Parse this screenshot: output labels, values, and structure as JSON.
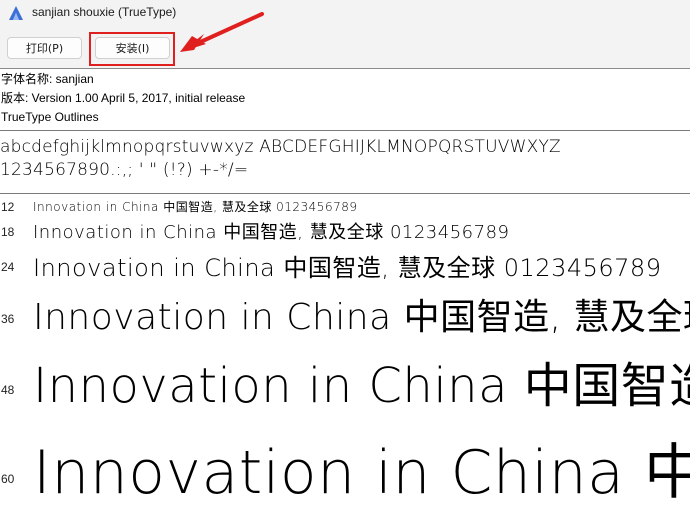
{
  "window": {
    "title": "sanjian shouxie (TrueType)"
  },
  "toolbar": {
    "print_label": "打印(P)",
    "install_label": "安装(I)"
  },
  "font_info": {
    "name_line": "字体名称: sanjian",
    "version_line": "版本: Version 1.00 April 5, 2017, initial release",
    "outline_line": "TrueType Outlines"
  },
  "charset": {
    "line1": "abcdefghijklmnopqrstuvwxyz  ABCDEFGHIJKLMNOPQRSTUVWXYZ",
    "line2": "1234567890.:,;  ' \"  (!?)  +-*/="
  },
  "samples": [
    {
      "size": "12",
      "text": "Innovation in China  中国智造, 慧及全球 0123456789"
    },
    {
      "size": "18",
      "text": "Innovation in China  中国智造, 慧及全球 0123456789"
    },
    {
      "size": "24",
      "text": "Innovation in China  中国智造, 慧及全球 0123456789"
    },
    {
      "size": "36",
      "text": "Innovation in China  中国智造, 慧及全球"
    },
    {
      "size": "48",
      "text": "Innovation in China  中国智造"
    },
    {
      "size": "60",
      "text": "Innovation in China  中"
    }
  ],
  "colors": {
    "highlight": "#e0201f",
    "toolbar_bg": "#f3f3f3"
  }
}
